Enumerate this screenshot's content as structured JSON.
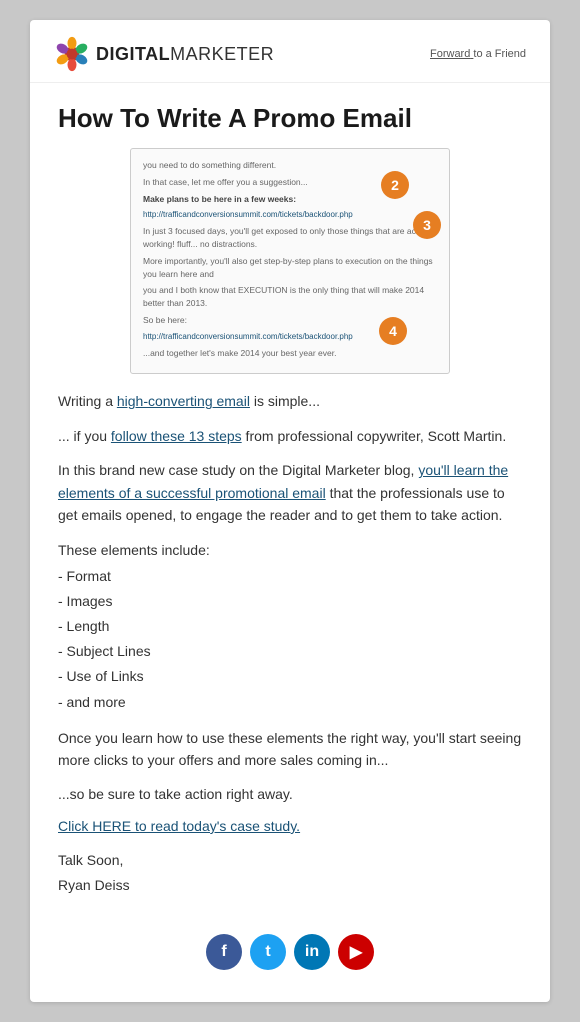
{
  "header": {
    "logo_strong": "DIGITAL",
    "logo_rest": "MARKETER",
    "forward_label": "Forward",
    "forward_to": " to a Friend"
  },
  "main": {
    "title": "How To Write A Promo Email",
    "screenshot": {
      "line1": "you need to do something different.",
      "line2": "In that case, let me offer you a suggestion...",
      "line3_bold": "Make plans to be here in a few weeks:",
      "line3_link": "http://trafficandconversionsummit.com/tickets/backdoor.php",
      "line4": "In just 3 focused days, you'll get exposed to only those things that are actually working! fluff... no distractions.",
      "line5a": "More importantly, you'll also get step-by-step plans to execution on the things you learn here and",
      "line5b": "you and I both know that EXECUTION is the only thing that will make 2014 better than 2013.",
      "line6": "So be here:",
      "line6_link": "http://trafficandconversionsummit.com/tickets/backdoor.php",
      "line7": "...and together let's make 2014 your best year ever.",
      "badge2": "2",
      "badge3": "3",
      "badge4": "4"
    },
    "para1": "Writing a ",
    "para1_link": "high-converting email",
    "para1_rest": " is simple...",
    "para2_pre": "... if you ",
    "para2_link": "follow these 13 steps",
    "para2_rest": " from professional copywriter, Scott Martin.",
    "para3_pre": "In this brand new case study on the Digital Marketer blog, ",
    "para3_link": "you'll learn the elements of a successful promotional email",
    "para3_rest": " that the professionals use to get emails opened, to engage the reader and to get them to take action.",
    "elements_intro": "These elements include:",
    "elements_list": [
      "- Format",
      "- Images",
      "- Length",
      "- Subject Lines",
      "- Use of Links",
      "- and more"
    ],
    "para4": "Once you learn how to use these elements the right way, you'll start seeing more clicks to your offers and more sales coming in...",
    "para5": "...so be sure to take action right away.",
    "cta_link": "Click HERE to read today's case study.",
    "signoff1": "Talk Soon,",
    "signoff2": "Ryan Deiss"
  },
  "social": {
    "fb_label": "f",
    "tw_label": "t",
    "li_label": "in",
    "yt_label": "▶"
  }
}
